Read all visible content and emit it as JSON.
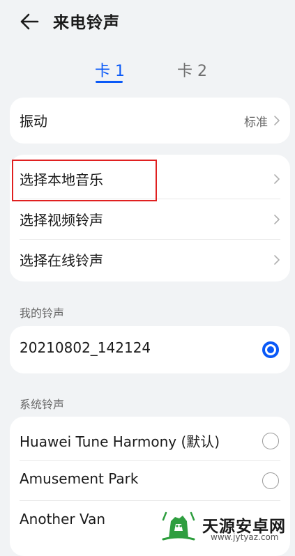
{
  "header": {
    "title": "来电铃声",
    "back_icon": "arrow-left-icon"
  },
  "tabs": [
    {
      "label": "卡 1",
      "active": true
    },
    {
      "label": "卡 2",
      "active": false
    }
  ],
  "vibration": {
    "label": "振动",
    "value": "标准"
  },
  "ringtone_sources": [
    {
      "label": "选择本地音乐"
    },
    {
      "label": "选择视频铃声"
    },
    {
      "label": "选择在线铃声"
    }
  ],
  "my_ringtones": {
    "section_label": "我的铃声",
    "items": [
      {
        "label": "20210802_142124",
        "selected": true
      }
    ]
  },
  "system_ringtones": {
    "section_label": "系统铃声",
    "items": [
      {
        "label": "Huawei Tune Harmony (默认)",
        "selected": false
      },
      {
        "label": "Amusement Park",
        "selected": false
      },
      {
        "label": "Another Van",
        "selected": false
      }
    ]
  },
  "watermark": {
    "title": "天源安卓网",
    "url": "www.jytyaz.com"
  },
  "colors": {
    "accent": "#0a59f7",
    "highlight_box": "#e02020",
    "background": "#f1f3f5"
  }
}
